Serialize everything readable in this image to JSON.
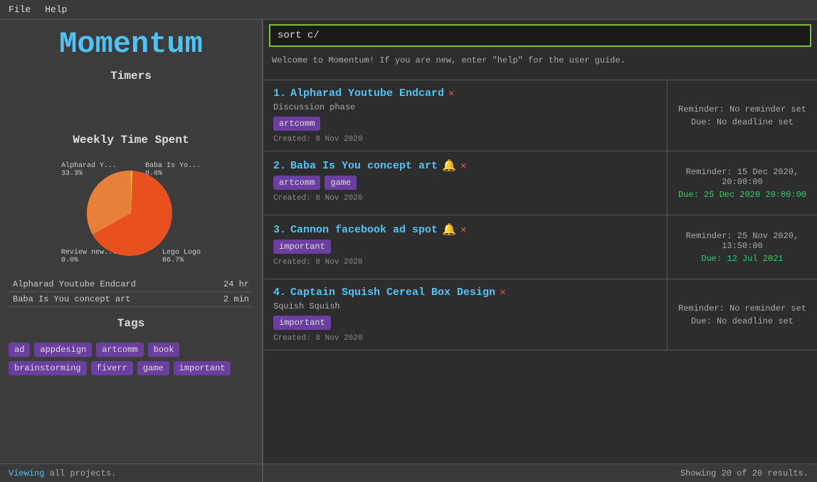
{
  "menubar": {
    "items": [
      "File",
      "Help"
    ]
  },
  "app": {
    "title": "Momentum"
  },
  "timers": {
    "label": "Timers"
  },
  "weekly": {
    "label": "Weekly Time Spent",
    "chart": {
      "segments": [
        {
          "label": "Alpharad Y...",
          "percent": "33.3%",
          "color": "#e8803a",
          "angle_start": 0,
          "angle_end": 120
        },
        {
          "label": "Baba Is Yo...",
          "percent": "0.0%",
          "color": "#f0c040",
          "angle_start": 120,
          "angle_end": 121
        },
        {
          "label": "Lego Logo",
          "percent": "66.7%",
          "color": "#e85020",
          "angle_start": 121,
          "angle_end": 360
        },
        {
          "label": "Review new...",
          "percent": "0.0%",
          "color": "#a0a0a0",
          "angle_start": 360,
          "angle_end": 360
        }
      ]
    },
    "time_entries": [
      {
        "name": "Alpharad Youtube Endcard",
        "time": "24 hr"
      },
      {
        "name": "Baba Is You concept art",
        "time": "2 min"
      }
    ]
  },
  "tags": {
    "label": "Tags",
    "items": [
      "ad",
      "appdesign",
      "artcomm",
      "book",
      "brainstorming",
      "fiverr",
      "game",
      "important"
    ]
  },
  "status_left": {
    "text": "Viewing all projects.",
    "viewing": "Viewing"
  },
  "search": {
    "value": "sort c/",
    "placeholder": "sort c/"
  },
  "welcome": {
    "text": "Welcome to Momentum! If you are new, enter \"help\" for the user guide."
  },
  "projects": [
    {
      "number": "1.",
      "title": "Alpharad Youtube Endcard",
      "has_bell": false,
      "has_x": true,
      "phase": "Discussion phase",
      "tags": [
        "artcomm"
      ],
      "created": "Created: 8 Nov 2020",
      "reminder": "Reminder: No reminder set",
      "due": "Due: No deadline set",
      "due_color": "no-deadline"
    },
    {
      "number": "2.",
      "title": "Baba Is You concept art",
      "has_bell": true,
      "has_x": true,
      "phase": "",
      "tags": [
        "artcomm",
        "game"
      ],
      "created": "Created: 8 Nov 2020",
      "reminder": "Reminder: 15 Dec 2020, 20:00:00",
      "due": "Due: 25 Dec 2020 20:00:00",
      "due_color": "has-deadline"
    },
    {
      "number": "3.",
      "title": "Cannon facebook ad spot",
      "has_bell": true,
      "has_x": true,
      "phase": "",
      "tags": [
        "important"
      ],
      "created": "Created: 8 Nov 2020",
      "reminder": "Reminder: 25 Nov 2020, 13:50:00",
      "due": "Due: 12 Jul 2021",
      "due_color": "has-deadline"
    },
    {
      "number": "4.",
      "title": "Captain Squish Cereal Box Design",
      "has_bell": false,
      "has_x": true,
      "phase": "Squish Squish",
      "tags": [
        "important"
      ],
      "created": "Created: 8 Nov 2020",
      "reminder": "Reminder: No reminder set",
      "due": "Due: No deadline set",
      "due_color": "no-deadline"
    }
  ],
  "status_right": {
    "text": "Showing 20 of 20 results."
  }
}
